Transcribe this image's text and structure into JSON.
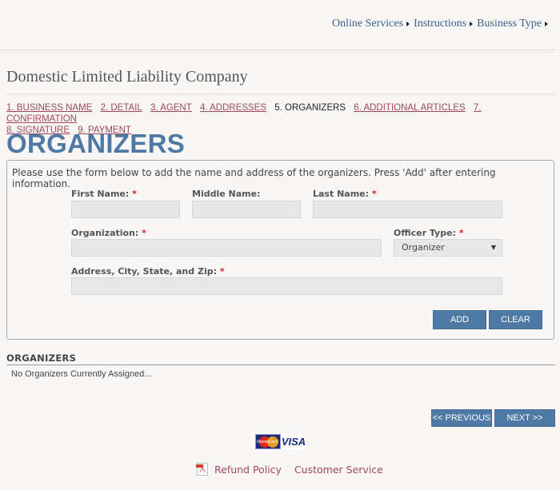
{
  "topnav": {
    "items": [
      {
        "label": "Online Services",
        "icon": "triangle-right-icon"
      },
      {
        "label": "Instructions",
        "icon": "triangle-right-icon"
      },
      {
        "label": "Business Type",
        "icon": "triangle-right-icon"
      }
    ]
  },
  "page": {
    "title": "Domestic Limited Liability Company",
    "section_title": "ORGANIZERS"
  },
  "steps": [
    {
      "label": "1. BUSINESS NAME",
      "current": false
    },
    {
      "label": "2. DETAIL",
      "current": false
    },
    {
      "label": "3. AGENT",
      "current": false
    },
    {
      "label": "4. ADDRESSES",
      "current": false
    },
    {
      "label": "5. ORGANIZERS",
      "current": true
    },
    {
      "label": "6. ADDITIONAL ARTICLES",
      "current": false
    },
    {
      "label": "7. CONFIRMATION",
      "current": false
    },
    {
      "label": "8. SIGNATURE",
      "current": false
    },
    {
      "label": "9. PAYMENT",
      "current": false
    }
  ],
  "form": {
    "intro": "Please use the form below to add the name and address of the organizers. Press 'Add' after entering information.",
    "required_marker": "*",
    "fields": {
      "first_name": {
        "label": "First Name:",
        "required": true,
        "value": ""
      },
      "middle_name": {
        "label": "Middle Name:",
        "required": false,
        "value": ""
      },
      "last_name": {
        "label": "Last Name:",
        "required": true,
        "value": ""
      },
      "organization": {
        "label": "Organization:",
        "required": true,
        "value": ""
      },
      "officer_type": {
        "label": "Officer Type:",
        "required": true,
        "value": "Organizer"
      },
      "address": {
        "label": "Address, City, State, and Zip:",
        "required": true,
        "value": ""
      }
    },
    "buttons": {
      "add": "ADD",
      "clear": "CLEAR"
    }
  },
  "organizers_list": {
    "header": "ORGANIZERS",
    "empty_text": "No Organizers Currently Assigned..."
  },
  "nav_buttons": {
    "previous": "<< PREVIOUS",
    "next": "NEXT >>"
  },
  "payment_logos": {
    "mastercard": "MasterCard",
    "visa": "VISA"
  },
  "footer": {
    "refund_policy": "Refund Policy",
    "customer_service": "Customer Service"
  },
  "colors": {
    "accent_blue": "#4f79a5",
    "link_red": "#a0475b",
    "required_red": "#e02020"
  }
}
